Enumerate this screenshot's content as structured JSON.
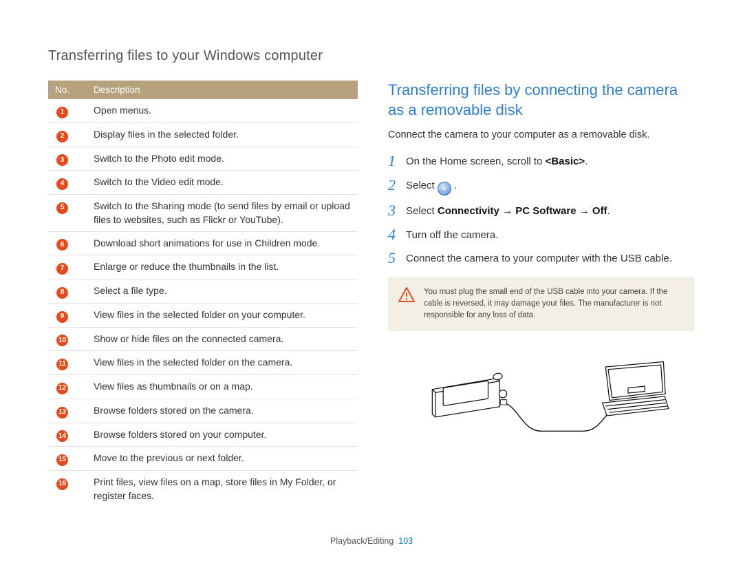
{
  "page_title": "Transferring files to your Windows computer",
  "table": {
    "headers": {
      "no": "No.",
      "desc": "Description"
    },
    "rows": [
      {
        "n": "1",
        "d": "Open menus."
      },
      {
        "n": "2",
        "d": "Display files in the selected folder."
      },
      {
        "n": "3",
        "d": "Switch to the Photo edit mode."
      },
      {
        "n": "4",
        "d": "Switch to the Video edit mode."
      },
      {
        "n": "5",
        "d": "Switch to the Sharing mode (to send files by email or upload files to websites, such as Flickr or YouTube)."
      },
      {
        "n": "6",
        "d": "Download short animations for use in Children mode."
      },
      {
        "n": "7",
        "d": "Enlarge or reduce the thumbnails in the list."
      },
      {
        "n": "8",
        "d": "Select a file type."
      },
      {
        "n": "9",
        "d": "View files in the selected folder on your computer."
      },
      {
        "n": "10",
        "d": "Show or hide files on the connected camera."
      },
      {
        "n": "11",
        "d": "View files in the selected folder on the camera."
      },
      {
        "n": "12",
        "d": "View files as thumbnails or on a map."
      },
      {
        "n": "13",
        "d": "Browse folders stored on the camera."
      },
      {
        "n": "14",
        "d": "Browse folders stored on your computer."
      },
      {
        "n": "15",
        "d": "Move to the previous or next folder."
      },
      {
        "n": "16",
        "d": "Print files, view files on a map, store files in My Folder, or register faces."
      }
    ]
  },
  "section": {
    "heading": "Transferring files by connecting the camera as a removable disk",
    "intro": "Connect the camera to your computer as a removable disk.",
    "steps": {
      "s1_pre": "On the Home screen, scroll to ",
      "s1_bold": "<Basic>",
      "s1_post": ".",
      "s2_pre": "Select ",
      "s2_post": " .",
      "s3_pre": "Select ",
      "s3_bold": "Connectivity → PC Software → Off",
      "s3_post": ".",
      "s4": "Turn off the camera.",
      "s5": "Connect the camera to your computer with the USB cable."
    },
    "step_numbers": {
      "s1": "1",
      "s2": "2",
      "s3": "3",
      "s4": "4",
      "s5": "5"
    },
    "warning": "You must plug the small end of the USB cable into your camera. If the cable is reversed, it may damage your files. The manufacturer is not responsible for any loss of data."
  },
  "footer": {
    "label": "Playback/Editing",
    "page": "103"
  }
}
